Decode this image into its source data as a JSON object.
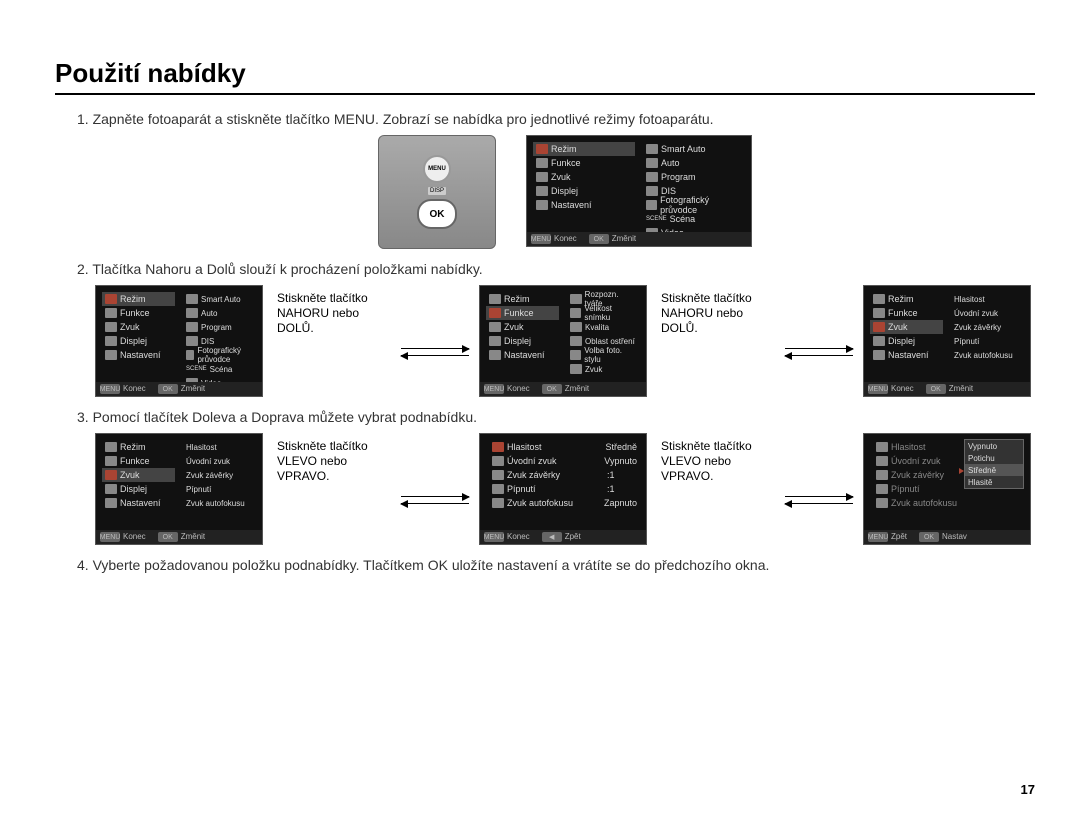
{
  "page": {
    "title": "Použití nabídky",
    "number": "17"
  },
  "steps": {
    "s1": "1. Zapněte fotoaparát a stiskněte tlačítko MENU. Zobrazí se nabídka pro jednotlivé režimy fotoaparátu.",
    "s2": "2. Tlačítka Nahoru a Dolů slouží k procházení položkami nabídky.",
    "s3": "3. Pomocí tlačítek Doleva a Doprava můžete vybrat podnabídku.",
    "s4": "4. Vyberte požadovanou položku podnabídky. Tlačítkem OK uložíte nastavení a vrátíte se do předchozího okna."
  },
  "captions": {
    "updown": "Stiskněte tlačítko NAHORU nebo DOLŮ.",
    "leftright": "Stiskněte tlačítko VLEVO nebo VPRAVO."
  },
  "camera": {
    "menu": "MENU",
    "disp": "DISP",
    "ok": "OK"
  },
  "foot": {
    "menu": "MENU",
    "ok": "OK",
    "back": "◀",
    "konec": "Konec",
    "zmenit": "Změnit",
    "zpet": "Zpět",
    "nastav": "Nastav"
  },
  "leftMenu": {
    "rezim": "Režim",
    "funkce": "Funkce",
    "zvuk": "Zvuk",
    "displej": "Displej",
    "nastaveni": "Nastavení"
  },
  "modes": {
    "smart": "Smart Auto",
    "auto": "Auto",
    "program": "Program",
    "dis": "DIS",
    "fprv": "Fotografický průvodce",
    "scena": "Scéna",
    "video": "Video"
  },
  "funkce": {
    "rozpozn": "Rozpozn. tváře",
    "velikost": "Velikost snímku",
    "kvalita": "Kvalita",
    "oblast": "Oblast ostření",
    "volba": "Volba foto. stylu",
    "zvuk": "Zvuk"
  },
  "zvuk": {
    "hlasitost": "Hlasitost",
    "uvodni": "Úvodní zvuk",
    "zaverky": "Zvuk závěrky",
    "pipnuti": "Pípnutí",
    "autofokus": "Zvuk autofokusu"
  },
  "values": {
    "stredne": "Středně",
    "vypnuto": "Vypnuto",
    "one": "1",
    "zapnuto": "Zapnuto",
    "potichu": "Potichu",
    "hlasite": "Hlasitě"
  }
}
